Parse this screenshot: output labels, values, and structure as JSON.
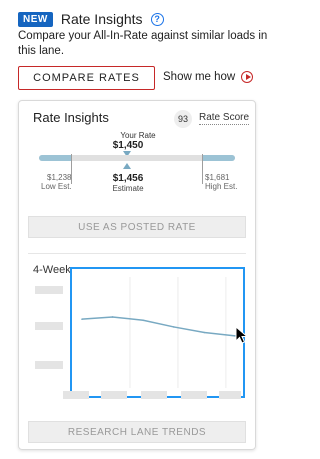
{
  "header": {
    "badge": "NEW",
    "title": "Rate Insights",
    "help_icon": "question-circle-icon"
  },
  "description": "Compare your All-In-Rate against similar loads in this lane.",
  "compare_button": "COMPARE RATES",
  "show_me_how": {
    "label": "Show me how",
    "icon": "play-circle-icon"
  },
  "card": {
    "title": "Rate Insights",
    "score": "93",
    "score_label": "Rate Score",
    "your_rate": {
      "label": "Your Rate",
      "value": "$1,450"
    },
    "low": {
      "value": "$1,238",
      "label": "Low Est."
    },
    "estimate": {
      "value": "$1,456",
      "label": "Estimate"
    },
    "high": {
      "value": "$1,681",
      "label": "High Est."
    },
    "use_button": "USE AS POSTED RATE",
    "trend_label": "4-Week",
    "research_button": "RESEARCH LANE TRENDS"
  },
  "chart_data": {
    "type": "line",
    "x": [
      0,
      1,
      2,
      3,
      4,
      5
    ],
    "values": [
      0.62,
      0.64,
      0.61,
      0.55,
      0.5,
      0.47
    ],
    "ylim": [
      0,
      1
    ]
  },
  "colors": {
    "accent": "#1565c0",
    "brand_red": "#c62828",
    "highlight_blue": "#2196f3",
    "range_blue": "#9cc3d5"
  }
}
